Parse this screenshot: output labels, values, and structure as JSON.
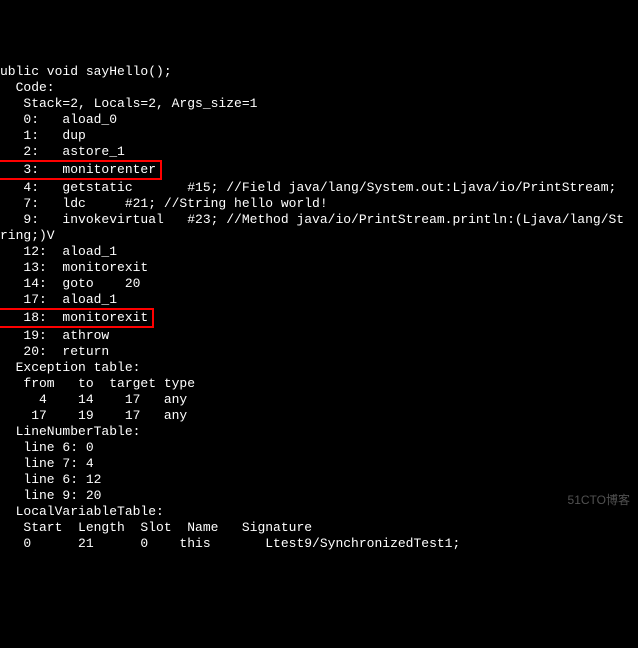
{
  "lines": [
    "ublic void sayHello();",
    "  Code:",
    "   Stack=2, Locals=2, Args_size=1",
    "   0:   aload_0",
    "   1:   dup",
    "   2:   astore_1",
    "   3:   monitorenter",
    "   4:   getstatic       #15; //Field java/lang/System.out:Ljava/io/PrintStream;",
    "   7:   ldc     #21; //String hello world!",
    "   9:   invokevirtual   #23; //Method java/io/PrintStream.println:(Ljava/lang/St",
    "ring;)V",
    "   12:  aload_1",
    "   13:  monitorexit",
    "   14:  goto    20",
    "   17:  aload_1",
    "   18:  monitorexit",
    "   19:  athrow",
    "   20:  return",
    "  Exception table:",
    "   from   to  target type",
    "     4    14    17   any",
    "    17    19    17   any",
    "  LineNumberTable:",
    "   line 6: 0",
    "   line 7: 4",
    "   line 6: 12",
    "   line 9: 20",
    "",
    "  LocalVariableTable:",
    "   Start  Length  Slot  Name   Signature",
    "   0      21      0    this       Ltest9/SynchronizedTest1;"
  ],
  "highlighted_lines": [
    6,
    15
  ],
  "watermark": "51CTO博客"
}
